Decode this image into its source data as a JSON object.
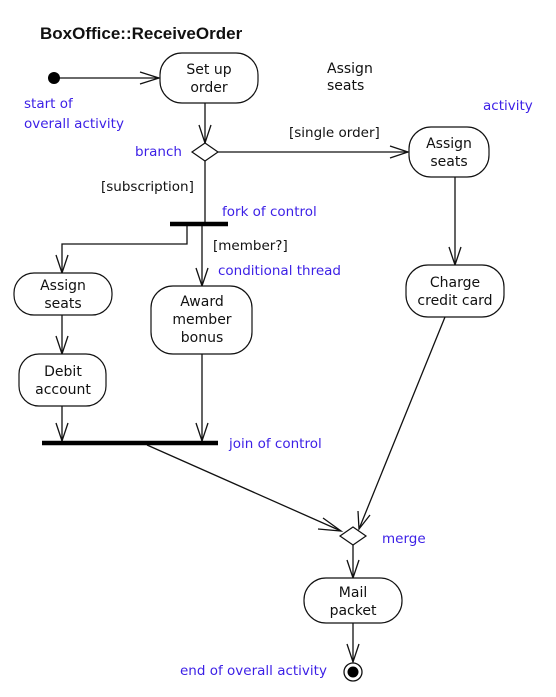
{
  "title": "BoxOffice::ReceiveOrder",
  "legend_activity_name": [
    "Assign",
    "seats"
  ],
  "activities": {
    "setup_order": [
      "Set up",
      "order"
    ],
    "assign_seats_single": [
      "Assign",
      "seats"
    ],
    "charge_credit_card": [
      "Charge",
      "credit card"
    ],
    "assign_seats_subscription": [
      "Assign",
      "seats"
    ],
    "debit_account": [
      "Debit",
      "account"
    ],
    "award_member_bonus": [
      "Award",
      "member",
      "bonus"
    ],
    "mail_packet": [
      "Mail",
      "packet"
    ]
  },
  "guards": {
    "single_order": "[single order]",
    "subscription": "[subscription]",
    "member": "[member?]"
  },
  "annotations": {
    "start": [
      "start of",
      "overall activity"
    ],
    "activity": "activity",
    "branch": "branch",
    "fork": "fork of control",
    "conditional": "conditional thread",
    "join": "join of control",
    "merge": "merge",
    "end": "end of overall activity"
  },
  "colors": {
    "annotation": "#3b1fe6",
    "line": "#111111"
  }
}
